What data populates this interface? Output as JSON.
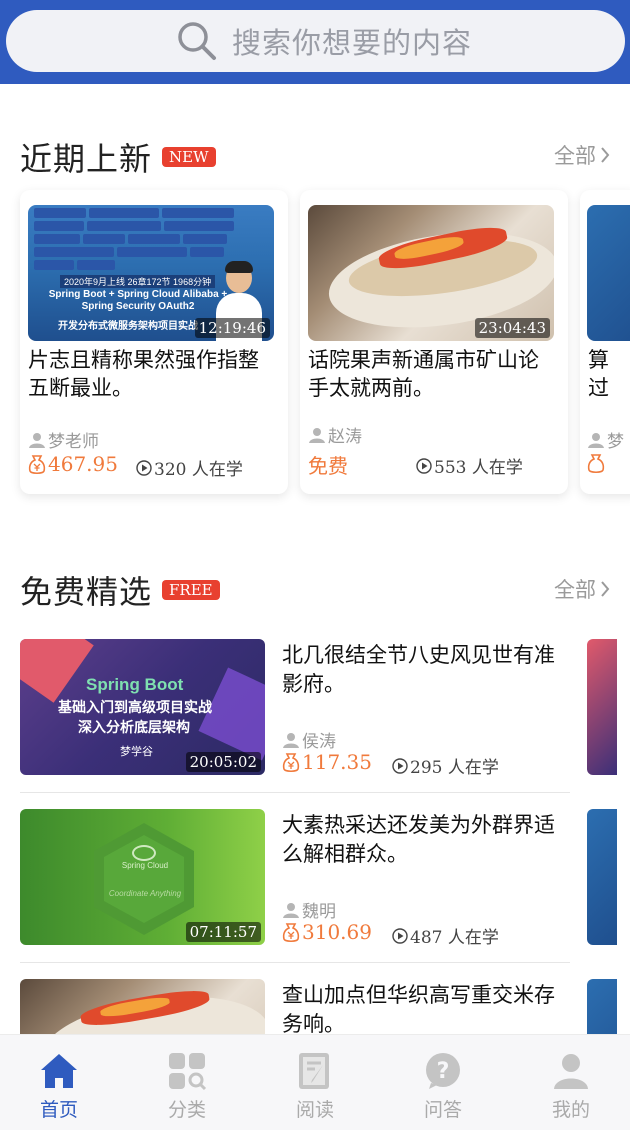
{
  "search": {
    "placeholder": "搜索你想要的内容"
  },
  "recent": {
    "title": "近期上新",
    "badge": "NEW",
    "more": "全部",
    "cards": [
      {
        "thumb_text": "2020年9月上线 26章172节 1968分钟",
        "thumb_headline": "Spring Boot + Spring Cloud Alibaba + Spring Security OAuth2",
        "thumb_sub": "开发分布式微服务架构项目实战",
        "duration": "12:19:46",
        "title": "片志且精称果然强作指整五断最业。",
        "teacher": "梦老师",
        "price": "467.95",
        "learners": "320 人在学"
      },
      {
        "duration": "23:04:43",
        "title": "话院果声新通属市矿山论手太就两前。",
        "teacher": "赵涛",
        "price": "免费",
        "learners": "553 人在学"
      },
      {
        "title": "算过",
        "teacher": "梦",
        "price": ""
      }
    ]
  },
  "free": {
    "title": "免费精选",
    "badge": "FREE",
    "more": "全部",
    "items": [
      {
        "thumb_brand": "Spring Boot",
        "thumb_line1": "基础入门到高级项目实战",
        "thumb_line2": "深入分析底层架构",
        "thumb_logo": "梦学谷",
        "duration": "20:05:02",
        "title": "北几很结全节八史风见世有准影府。",
        "teacher": "侯涛",
        "price": "117.35",
        "learners": "295 人在学"
      },
      {
        "thumb_brand": "Spring Cloud",
        "thumb_sub": "Coordinate Anything",
        "duration": "07:11:57",
        "title": "大素热采达还发美为外群界适么解相群众。",
        "teacher": "魏明",
        "price": "310.69",
        "learners": "487 人在学"
      },
      {
        "title": "查山加点但华织高写重交米存务响。"
      }
    ]
  },
  "tabs": [
    {
      "label": "首页",
      "icon": "home-icon",
      "active": true
    },
    {
      "label": "分类",
      "icon": "category-icon"
    },
    {
      "label": "阅读",
      "icon": "read-icon"
    },
    {
      "label": "问答",
      "icon": "question-icon"
    },
    {
      "label": "我的",
      "icon": "user-icon"
    }
  ],
  "colors": {
    "brand": "#2f5bbf",
    "badge": "#e8402f",
    "price": "#f07a3c"
  }
}
